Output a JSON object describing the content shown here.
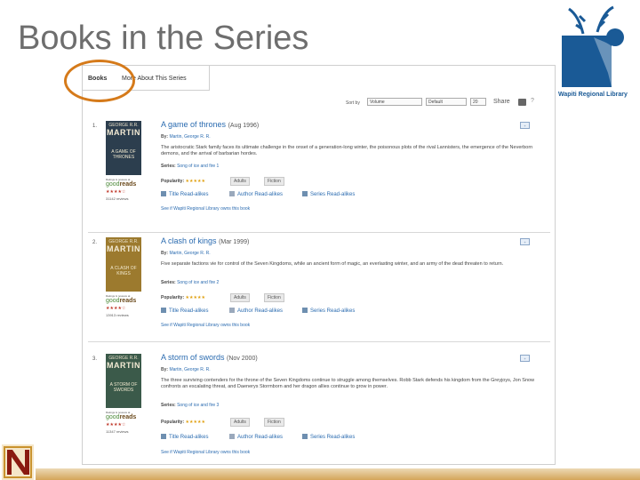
{
  "slide": {
    "title": "Books in the Series"
  },
  "logo": {
    "name": "Wapiti Regional Library"
  },
  "tabs": {
    "books": "Books",
    "more": "More About This Series"
  },
  "sortbar": {
    "label": "Sort by",
    "sort_value": "Volume",
    "order_value": "Default",
    "per_page": "20",
    "share": "Share",
    "help": "?"
  },
  "books": [
    {
      "number": "1.",
      "title": "A game of thrones",
      "date": "(Aug 1996)",
      "author_label": "By:",
      "author": "Martin, George R. R.",
      "description": "The aristocratic Stark family faces its ultimate challenge in the onset of a generation-long winter, the poisonous plots of the rival Lannisters, the emergence of the Neverborn demons, and the arrival of barbarian hordes.",
      "series_label": "Series:",
      "series": "Song of ice and fire 1",
      "popularity_label": "Popularity:",
      "popularity_stars": "★★★★★",
      "badge1": "Adults",
      "badge2": "Fiction",
      "title_readalikes": "Title Read-alikes",
      "author_readalikes": "Author Read-alikes",
      "series_readalikes": "Series Read-alikes",
      "see_link": "See if Wapiti Regional Library owns this book",
      "cover_author": "GEORGE R.R.",
      "cover_name": "MARTIN",
      "cover_title": "A GAME OF THRONES",
      "goodreads_small": "Ratings & reviews at",
      "goodreads_good": "good",
      "goodreads_reads": "reads",
      "rating_stars": "★★★★☆",
      "review_count": "31142 reviews"
    },
    {
      "number": "2.",
      "title": "A clash of kings",
      "date": "(Mar 1999)",
      "author_label": "By:",
      "author": "Martin, George R. R.",
      "description": "Five separate factions vie for control of the Seven Kingdoms, while an ancient form of magic, an everlasting winter, and an army of the dead threaten to return.",
      "series_label": "Series:",
      "series": "Song of ice and fire 2",
      "popularity_label": "Popularity:",
      "popularity_stars": "★★★★★",
      "badge1": "Adults",
      "badge2": "Fiction",
      "title_readalikes": "Title Read-alikes",
      "author_readalikes": "Author Read-alikes",
      "series_readalikes": "Series Read-alikes",
      "see_link": "See if Wapiti Regional Library owns this book",
      "cover_author": "GEORGE R.R.",
      "cover_name": "MARTIN",
      "cover_title": "A CLASH OF KINGS",
      "goodreads_small": "Ratings & reviews at",
      "goodreads_good": "good",
      "goodreads_reads": "reads",
      "rating_stars": "★★★★☆",
      "review_count": "13913 reviews"
    },
    {
      "number": "3.",
      "title": "A storm of swords",
      "date": "(Nov 2000)",
      "author_label": "By:",
      "author": "Martin, George R. R.",
      "description": "The three surviving contenders for the throne of the Seven Kingdoms continue to struggle among themselves. Robb Stark defends his kingdom from the Greyjoys, Jon Snow confronts an escalating threat, and Daenerys Stormborn and her dragon allies continue to grow in power.",
      "series_label": "Series:",
      "series": "Song of ice and fire 3",
      "popularity_label": "Popularity:",
      "popularity_stars": "★★★★★",
      "badge1": "Adults",
      "badge2": "Fiction",
      "title_readalikes": "Title Read-alikes",
      "author_readalikes": "Author Read-alikes",
      "series_readalikes": "Series Read-alikes",
      "see_link": "See if Wapiti Regional Library owns this book",
      "cover_author": "GEORGE R.R.",
      "cover_name": "MARTIN",
      "cover_title": "A STORM OF SWORDS",
      "goodreads_small": "Ratings & reviews at",
      "goodreads_good": "good",
      "goodreads_reads": "reads",
      "rating_stars": "★★★★☆",
      "review_count": "11347 reviews"
    }
  ],
  "colors": {
    "title_gray": "#6e6e6e",
    "link_blue": "#2a6bb0",
    "annotation_orange": "#d57a1a",
    "logo_blue": "#1a5a96"
  }
}
